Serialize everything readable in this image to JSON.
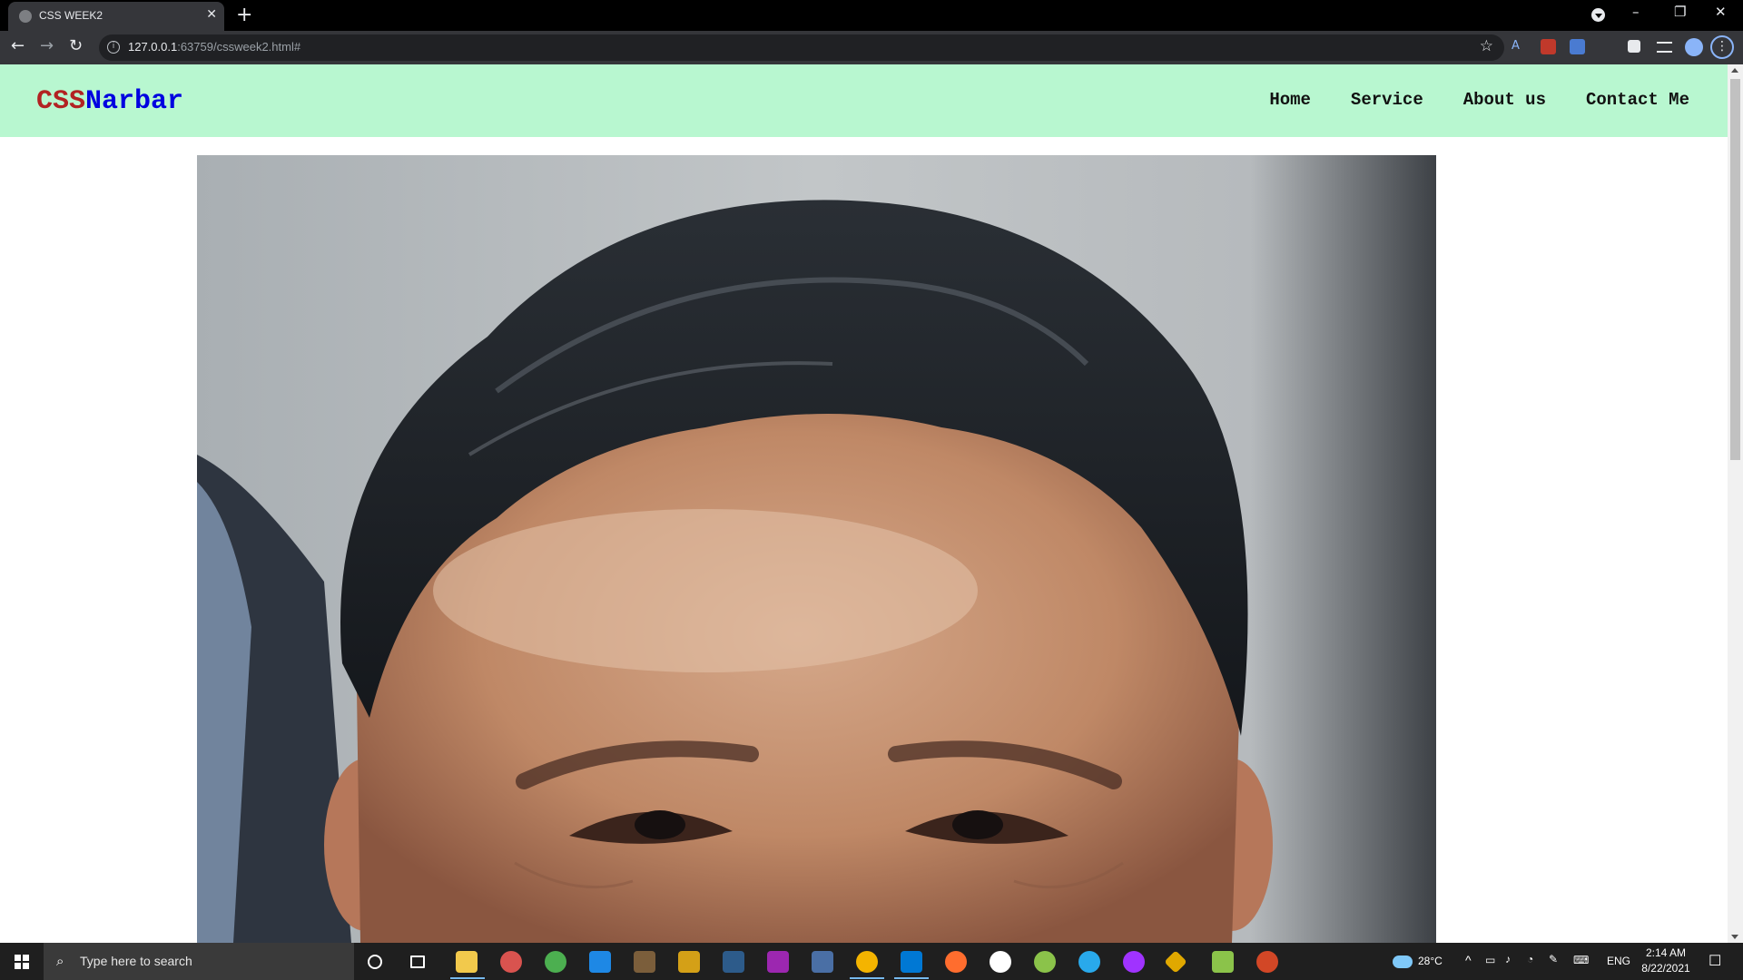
{
  "browser": {
    "tab_title": "CSS WEEK2",
    "tab_close": "✕",
    "new_tab": "+",
    "url_host": "127.0.0.1",
    "url_rest": ":63759/cssweek2.html#",
    "window_controls": {
      "minimize": "–",
      "restore": "❐",
      "close": "✕"
    },
    "nav": {
      "back": "←",
      "forward": "→",
      "reload": "↻"
    },
    "menu": "⋮",
    "star": "☆"
  },
  "site": {
    "brand_part1": "CSS",
    "brand_part2": "Narbar",
    "nav_links": [
      "Home",
      "Service",
      "About us",
      "Contact Me"
    ],
    "hero_image": "portrait-photo"
  },
  "taskbar": {
    "search_placeholder": "Type here to search",
    "weather": "28°C",
    "language": "ENG",
    "time": "2:14 AM",
    "date": "8/22/2021"
  },
  "icons": [
    "start-icon",
    "search-icon",
    "cortana-icon",
    "task-view-icon",
    "file-explorer-icon",
    "chrome-icon",
    "vscode-icon",
    "telegram-icon",
    "messenger-icon",
    "powerpoint-icon"
  ]
}
